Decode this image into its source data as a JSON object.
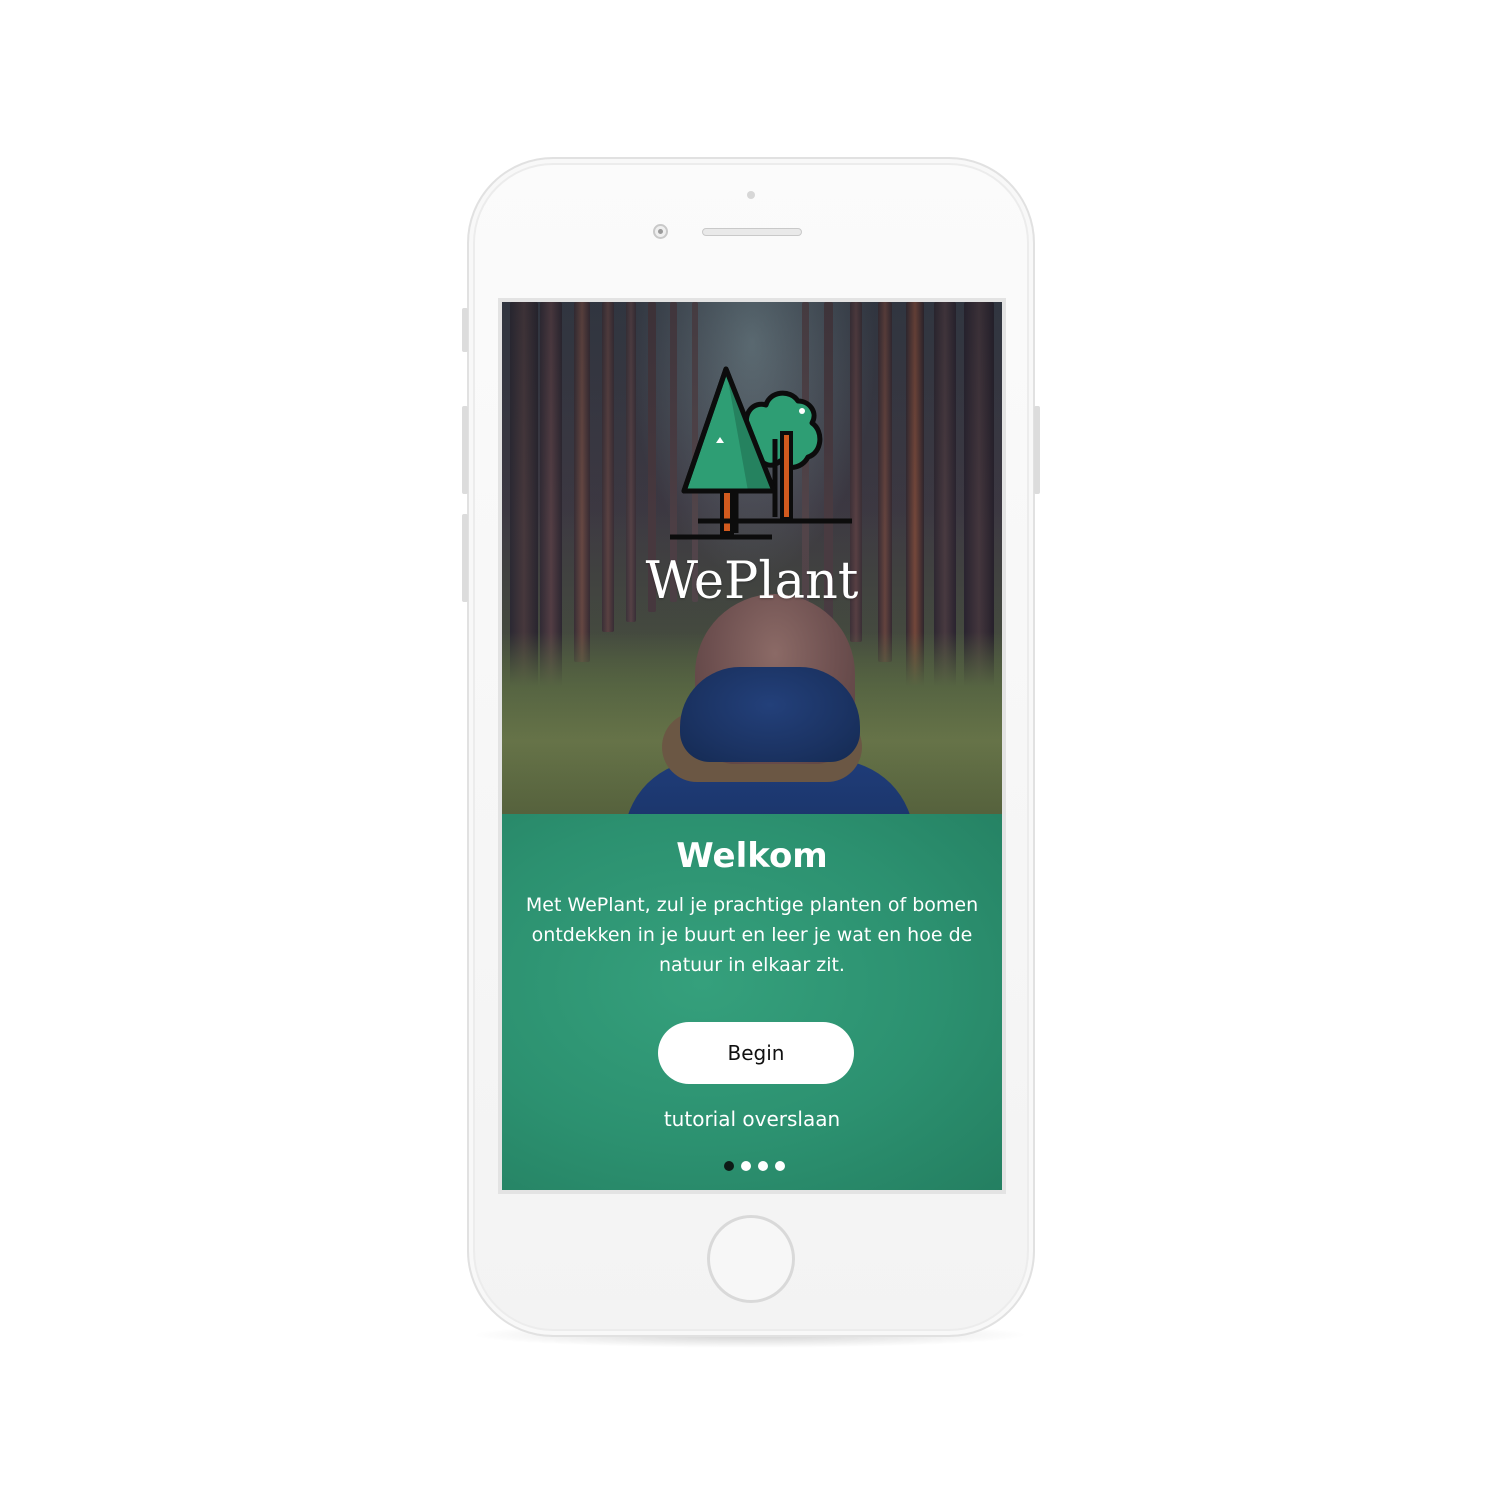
{
  "app": {
    "brand_name": "WePlant"
  },
  "welcome": {
    "title": "Welkom",
    "body": "Met WePlant, zul je prachtige planten of bomen ontdekken in je buurt en leer je wat en hoe de natuur in elkaar zit.",
    "primary_button": "Begin",
    "skip_link": "tutorial overslaan"
  },
  "pager": {
    "total_pages": 4,
    "current_page": 1
  },
  "icons": {
    "logo": "trees-logo-icon"
  },
  "colors": {
    "panel_green": "#2c9170",
    "logo_green": "#2e9e74",
    "trunk_orange": "#d25a1e",
    "button_bg": "#ffffff",
    "active_dot": "#0d1a16"
  }
}
